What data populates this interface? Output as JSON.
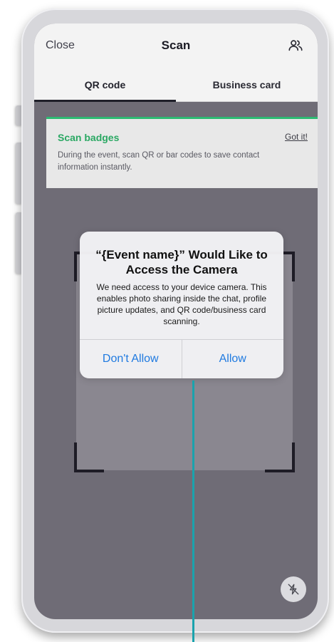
{
  "nav": {
    "close_label": "Close",
    "title": "Scan",
    "contacts_icon": "people-icon"
  },
  "tabs": [
    {
      "label": "QR code",
      "active": true
    },
    {
      "label": "Business card",
      "active": false
    }
  ],
  "banner": {
    "title": "Scan badges",
    "action_label": "Got it!",
    "body": "During the event, scan QR or bar codes to save contact information instantly."
  },
  "permission_dialog": {
    "title": "“{Event name}” Would Like to Access the Camera",
    "message": "We need access to your device camera. This enables photo sharing inside the chat, profile picture updates, and QR code/business card scanning.",
    "deny_label": "Don't Allow",
    "allow_label": "Allow"
  },
  "flash_toggle": {
    "icon": "flash-off-icon"
  },
  "colors": {
    "accent_green": "#2dbb73",
    "link_blue": "#1f7ae0",
    "scan_background": "#6f6c76",
    "annotation_teal": "#1aa3ad"
  }
}
